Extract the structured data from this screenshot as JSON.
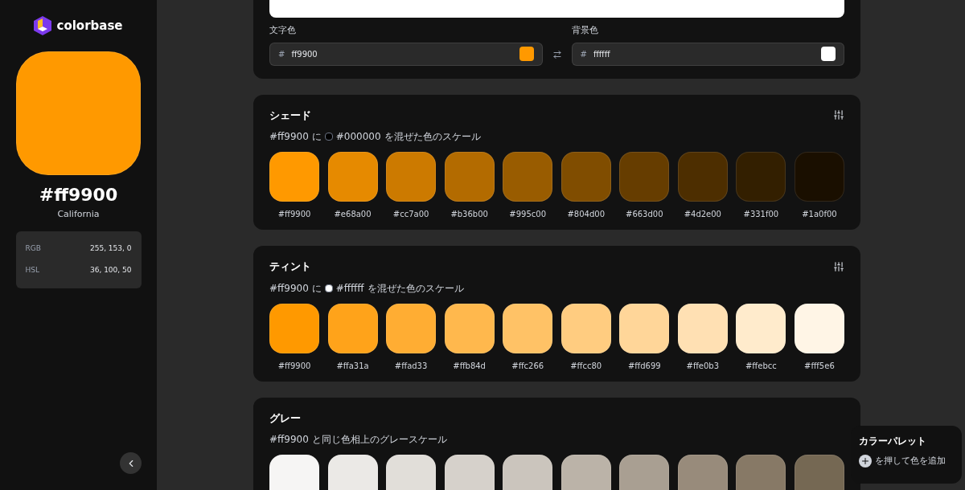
{
  "brand": {
    "name": "colorbase"
  },
  "color": {
    "hex": "#ff9900",
    "name": "California",
    "values": [
      {
        "label": "RGB",
        "value": "255, 153, 0"
      },
      {
        "label": "HSL",
        "value": "36, 100, 50"
      }
    ]
  },
  "contrast": {
    "fields": [
      {
        "label": "文字色",
        "prefix": "#",
        "value": "ff9900"
      },
      {
        "label": "背景色",
        "prefix": "#",
        "value": "ffffff"
      }
    ]
  },
  "sections": [
    {
      "title": "シェード",
      "before": "#ff9900 に",
      "mix": "#000000",
      "after": "を混ぜた色のスケール",
      "has_settings": true,
      "swatches": [
        {
          "color": "#ff9900",
          "label": "#ff9900"
        },
        {
          "color": "#e68a00",
          "label": "#e68a00"
        },
        {
          "color": "#cc7a00",
          "label": "#cc7a00"
        },
        {
          "color": "#b36b00",
          "label": "#b36b00"
        },
        {
          "color": "#995c00",
          "label": "#995c00"
        },
        {
          "color": "#804d00",
          "label": "#804d00"
        },
        {
          "color": "#663d00",
          "label": "#663d00"
        },
        {
          "color": "#4d2e00",
          "label": "#4d2e00"
        },
        {
          "color": "#331f00",
          "label": "#331f00"
        },
        {
          "color": "#1a0f00",
          "label": "#1a0f00"
        }
      ]
    },
    {
      "title": "ティント",
      "before": "#ff9900 に",
      "mix": "#ffffff",
      "after": "を混ぜた色のスケール",
      "has_settings": true,
      "swatches": [
        {
          "color": "#ff9900",
          "label": "#ff9900"
        },
        {
          "color": "#ffa31a",
          "label": "#ffa31a"
        },
        {
          "color": "#ffad33",
          "label": "#ffad33"
        },
        {
          "color": "#ffb84d",
          "label": "#ffb84d"
        },
        {
          "color": "#ffc266",
          "label": "#ffc266"
        },
        {
          "color": "#ffcc80",
          "label": "#ffcc80"
        },
        {
          "color": "#ffd699",
          "label": "#ffd699"
        },
        {
          "color": "#ffe0b3",
          "label": "#ffe0b3"
        },
        {
          "color": "#ffebcc",
          "label": "#ffebcc"
        },
        {
          "color": "#fff5e6",
          "label": "#fff5e6"
        }
      ]
    },
    {
      "title": "グレー",
      "before": "#ff9900 と同じ色相上のグレースケール",
      "has_settings": false,
      "swatches": [
        {
          "color": "#f6f5f4"
        },
        {
          "color": "#ebe9e6"
        },
        {
          "color": "#e1ded9"
        },
        {
          "color": "#d6d1cb"
        },
        {
          "color": "#cbc5bd"
        },
        {
          "color": "#bbb3a8"
        },
        {
          "color": "#a99f92"
        },
        {
          "color": "#988b7b"
        },
        {
          "color": "#877966"
        },
        {
          "color": "#756853"
        }
      ]
    }
  ],
  "palette": {
    "title": "カラーパレット",
    "hint": "を押して色を追加"
  }
}
